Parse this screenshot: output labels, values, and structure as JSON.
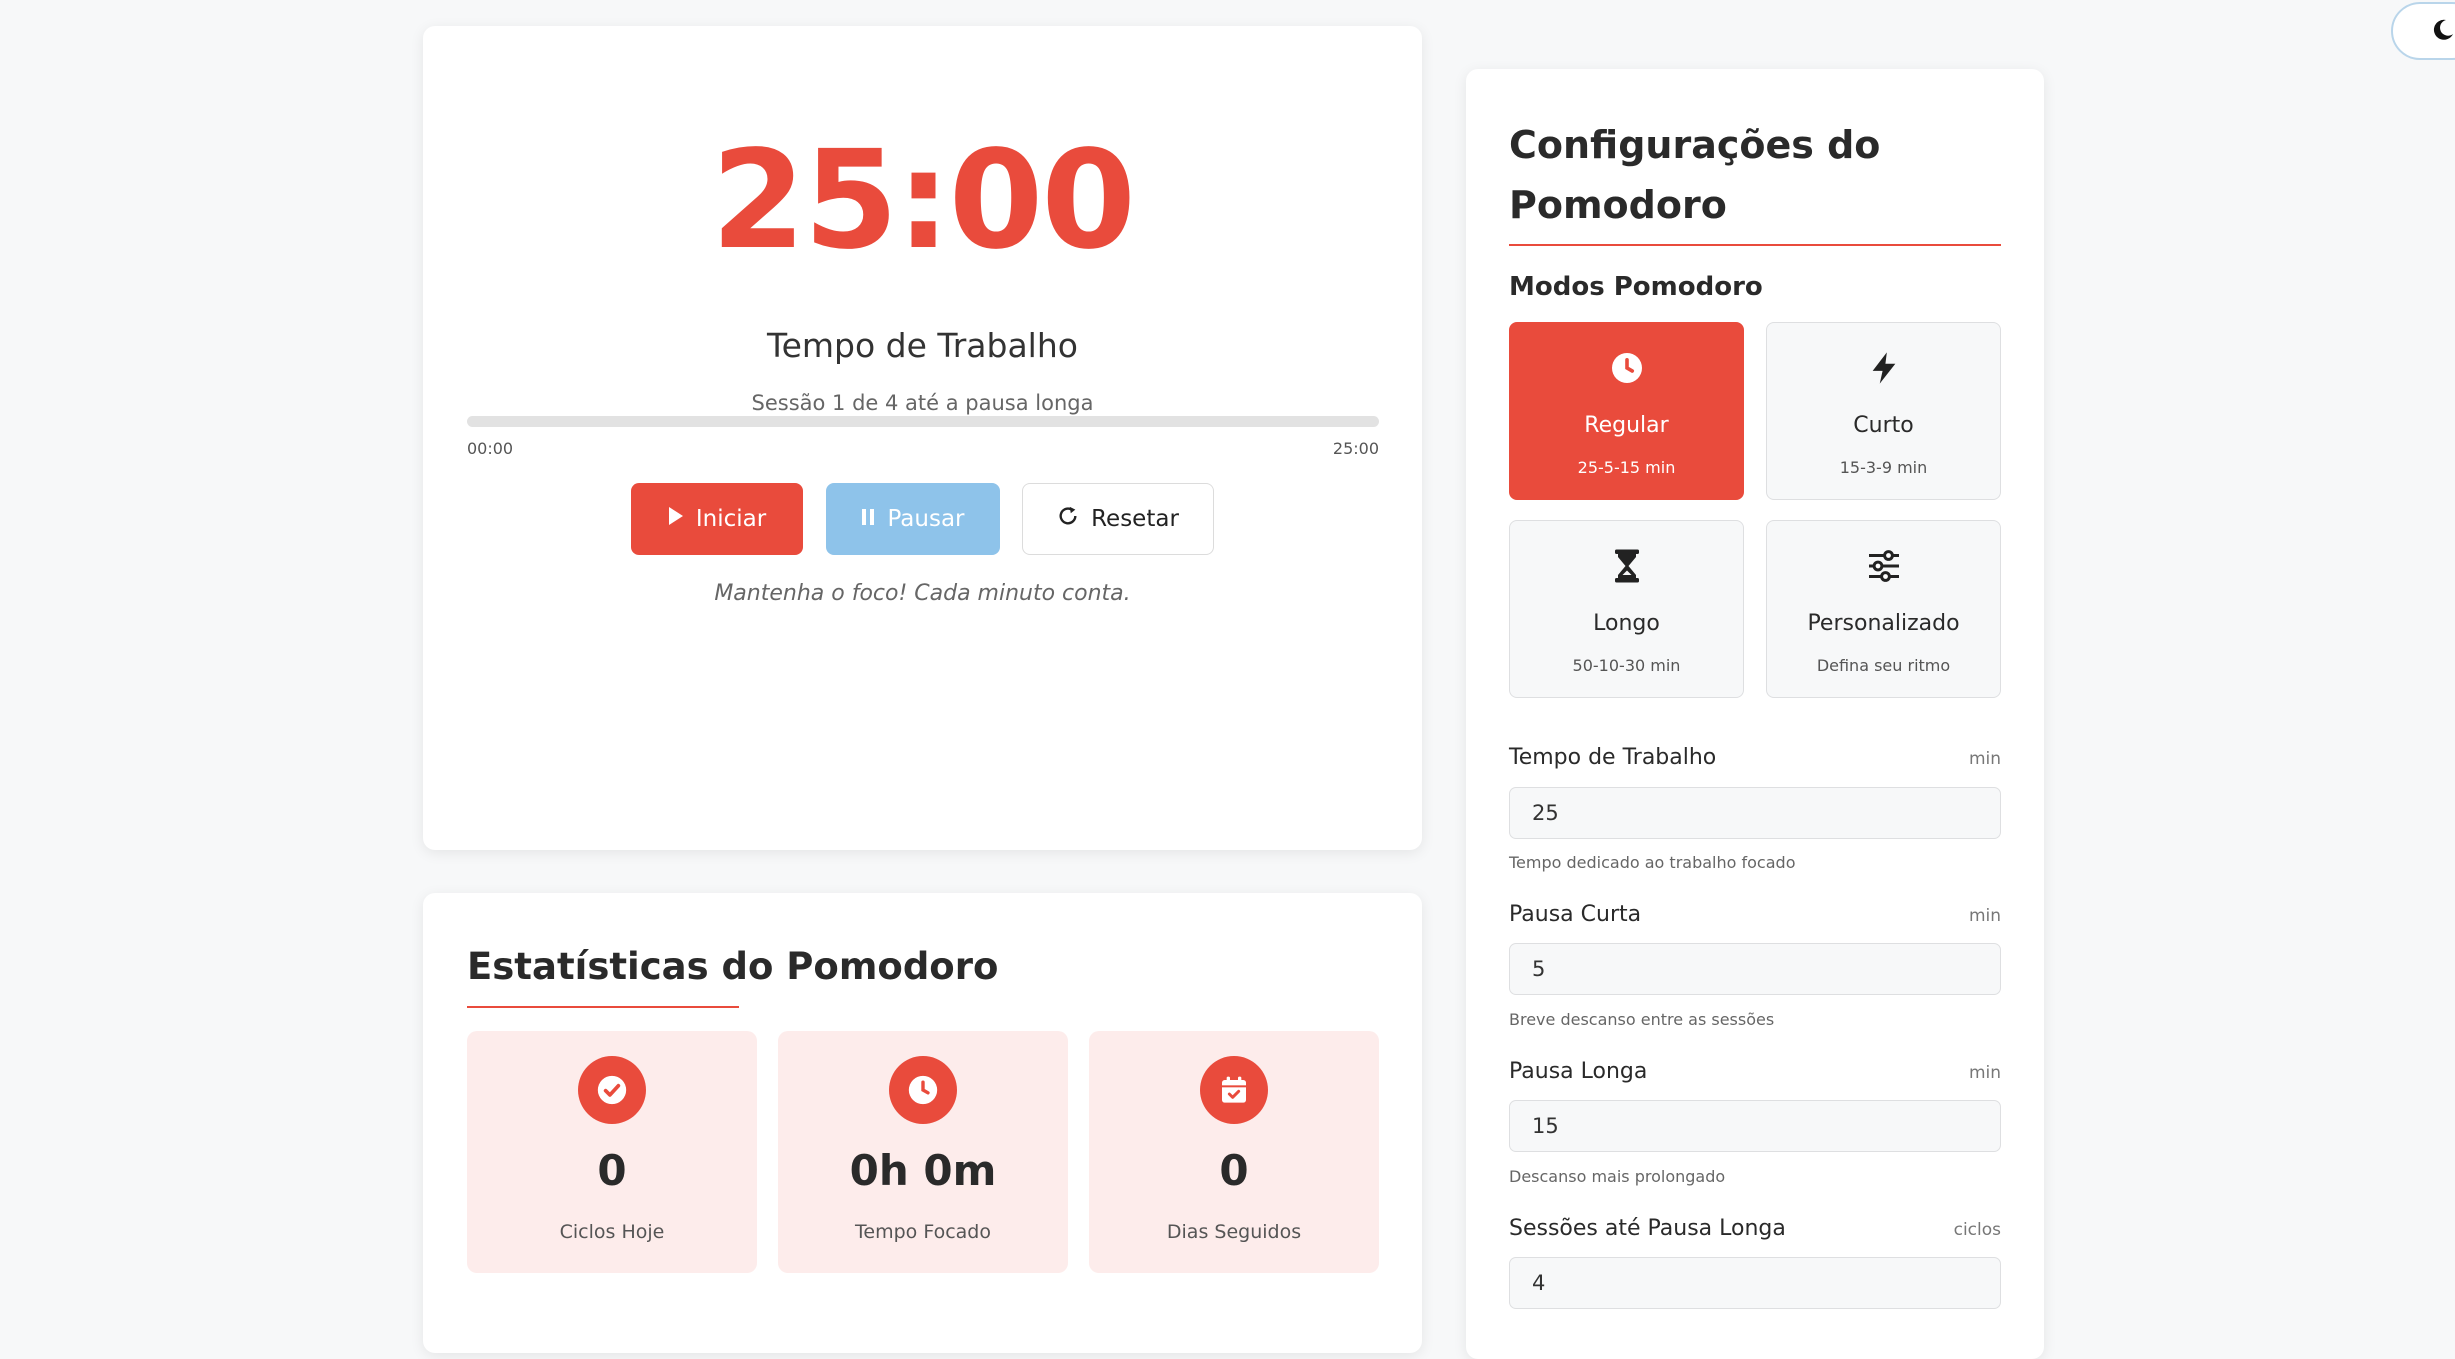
{
  "timer": {
    "time": "25:00",
    "phase": "Tempo de Trabalho",
    "session_info": "Sessão 1 de 4 até a pausa longa",
    "progress": 0,
    "elapsed_label": "00:00",
    "total_label": "25:00",
    "buttons": {
      "start": "Iniciar",
      "pause": "Pausar",
      "reset": "Resetar"
    },
    "motivation": "Mantenha o foco! Cada minuto conta."
  },
  "stats": {
    "title": "Estatísticas do Pomodoro",
    "items": [
      {
        "value": "0",
        "label": "Ciclos Hoje",
        "icon": "check-circle-icon"
      },
      {
        "value": "0h 0m",
        "label": "Tempo Focado",
        "icon": "clock-icon"
      },
      {
        "value": "0",
        "label": "Dias Seguidos",
        "icon": "calendar-check-icon"
      }
    ]
  },
  "settings": {
    "title": "Configurações do Pomodoro",
    "modes_title": "Modos Pomodoro",
    "modes": [
      {
        "name": "Regular",
        "desc": "25-5-15 min",
        "icon": "clock-icon",
        "active": true
      },
      {
        "name": "Curto",
        "desc": "15-3-9 min",
        "icon": "bolt-icon",
        "active": false
      },
      {
        "name": "Longo",
        "desc": "50-10-30 min",
        "icon": "hourglass-icon",
        "active": false
      },
      {
        "name": "Personalizado",
        "desc": "Defina seu ritmo",
        "icon": "sliders-icon",
        "active": false
      }
    ],
    "fields": [
      {
        "label": "Tempo de Trabalho",
        "unit": "min",
        "value": "25",
        "help": "Tempo dedicado ao trabalho focado"
      },
      {
        "label": "Pausa Curta",
        "unit": "min",
        "value": "5",
        "help": "Breve descanso entre as sessões"
      },
      {
        "label": "Pausa Longa",
        "unit": "min",
        "value": "15",
        "help": "Descanso mais prolongado"
      },
      {
        "label": "Sessões até Pausa Longa",
        "unit": "ciclos",
        "value": "4"
      }
    ]
  },
  "theme_toggle": {
    "icon": "moon-icon"
  },
  "colors": {
    "accent": "#e94b3c",
    "accent_light": "#fdeceb",
    "pause_button": "#8ec3ea",
    "background": "#f7f8f9"
  }
}
